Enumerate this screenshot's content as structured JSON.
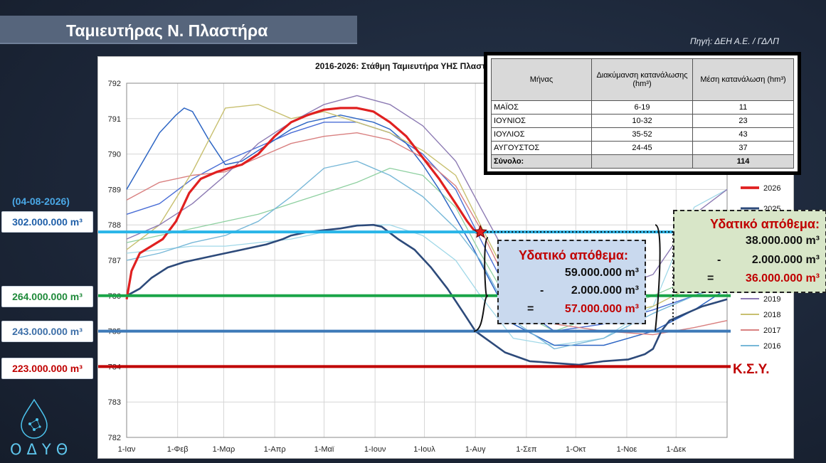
{
  "header": {
    "title": "Ταμιευτήρας Ν. Πλαστήρα",
    "source": "Πηγή: ΔΕΗ Α.Ε. / ΓΔΛΠ"
  },
  "left_panel": {
    "date": "(04-08-2026)",
    "levels": [
      {
        "label": "302.000.000 m³",
        "color": "#1f5fa8"
      },
      {
        "label": "264.000.000 m³",
        "color": "#1f8a3a"
      },
      {
        "label": "243.000.000 m³",
        "color": "#3d6fa8"
      },
      {
        "label": "223.000.000 m³",
        "color": "#c00000"
      }
    ]
  },
  "logo": {
    "text": "ΟΔΥΘ",
    "icon": "water-drop-icon"
  },
  "consumption_table": {
    "headers": [
      "Μήνας",
      "Διακύμανση κατανάλωσης (hm³)",
      "Μέση κατανάλωση (hm³)"
    ],
    "rows": [
      [
        "ΜΑΪΟΣ",
        "6-19",
        "11"
      ],
      [
        "ΙΟΥΝΙΟΣ",
        "10-32",
        "23"
      ],
      [
        "ΙΟΥΛΙΟΣ",
        "35-52",
        "43"
      ],
      [
        "ΑΥΓΟΥΣΤΟΣ",
        "24-45",
        "37"
      ]
    ],
    "total": [
      "Σύνολο:",
      "",
      "114"
    ]
  },
  "box_2026": {
    "title": "Υδατικό απόθεμα:",
    "line1": "59.000.000 m³",
    "line2_sign": "-",
    "line2": "2.000.000 m³",
    "line3_sign": "=",
    "line3": "57.000.000 m³"
  },
  "box_2025": {
    "title": "Υδατικό απόθεμα:",
    "line1": "38.000.000 m³",
    "line2_sign": "-",
    "line2": "2.000.000 m³",
    "line3_sign": "=",
    "line3": "36.000.000 m³"
  },
  "ksy_label": "Κ.Σ.Υ.",
  "colors": {
    "red": "#e02020",
    "dark_blue": "#2d4a7a",
    "light_blue": "#29b5e8",
    "green": "#1aa548",
    "mid_blue": "#3d79b8",
    "ksy_red": "#c00000"
  },
  "chart_data": {
    "type": "line",
    "title": "2016-2026: Στάθμη Ταμιευτήρα ΥΗΣ Πλαστήρα",
    "ylim": [
      782,
      792
    ],
    "yticks": [
      782,
      783,
      784,
      785,
      786,
      787,
      788,
      789,
      790,
      791,
      792
    ],
    "x_tick_labels": [
      "1-Ιαν",
      "1-Φεβ",
      "1-Μαρ",
      "1-Απρ",
      "1-Μαϊ",
      "1-Ιουν",
      "1-Ιουλ",
      "1-Αυγ",
      "1-Σεπ",
      "1-Οκτ",
      "1-Νοε",
      "1-Δεκ"
    ],
    "x_tick_days": [
      0,
      31,
      59,
      90,
      120,
      151,
      181,
      212,
      243,
      273,
      304,
      334
    ],
    "xlim": [
      0,
      365
    ],
    "reference_lines": [
      {
        "y": 787.8,
        "color": "#29b5e8"
      },
      {
        "y": 786.0,
        "color": "#1aa548"
      },
      {
        "y": 785.0,
        "color": "#3d79b8"
      },
      {
        "y": 784.0,
        "color": "#c00000"
      }
    ],
    "legend": [
      "2026",
      "2025",
      "2019",
      "2018",
      "2017",
      "2016"
    ],
    "series": [
      {
        "name": "2026",
        "color": "#e02020",
        "width": 3.2,
        "x": [
          0,
          3,
          8,
          15,
          22,
          30,
          38,
          45,
          55,
          62,
          70,
          80,
          90,
          95,
          100,
          110,
          120,
          130,
          140,
          150,
          160,
          170,
          180,
          190,
          200,
          207,
          212,
          215
        ],
        "y": [
          785.9,
          786.7,
          787.2,
          787.4,
          787.6,
          788.1,
          788.9,
          789.3,
          789.5,
          789.6,
          789.7,
          790.0,
          790.5,
          790.7,
          790.9,
          791.1,
          791.25,
          791.3,
          791.3,
          791.2,
          790.9,
          790.5,
          789.9,
          789.3,
          788.6,
          788.1,
          787.8,
          787.7
        ]
      },
      {
        "name": "2025",
        "color": "#2d4a7a",
        "width": 2.6,
        "x": [
          0,
          8,
          15,
          25,
          35,
          45,
          55,
          70,
          85,
          95,
          100,
          110,
          120,
          130,
          140,
          150,
          155,
          165,
          175,
          185,
          195,
          205,
          212,
          218,
          230,
          245,
          260,
          275,
          290,
          305,
          315,
          320,
          325,
          330,
          340,
          350,
          365
        ],
        "y": [
          786.0,
          786.2,
          786.5,
          786.8,
          786.95,
          787.05,
          787.15,
          787.3,
          787.45,
          787.6,
          787.7,
          787.8,
          787.85,
          787.9,
          787.98,
          788.0,
          787.95,
          787.6,
          787.3,
          786.8,
          786.2,
          785.5,
          785.0,
          784.8,
          784.4,
          784.15,
          784.1,
          784.05,
          784.15,
          784.2,
          784.35,
          784.5,
          785.0,
          785.3,
          785.5,
          785.7,
          785.9
        ]
      },
      {
        "name": "2019",
        "color": "#8c7ab3",
        "width": 1.4,
        "x": [
          0,
          20,
          40,
          60,
          80,
          100,
          120,
          140,
          160,
          180,
          200,
          215,
          235,
          260,
          290,
          320,
          345,
          365
        ],
        "y": [
          787.6,
          788.0,
          788.6,
          789.4,
          790.3,
          790.9,
          791.4,
          791.65,
          791.4,
          790.8,
          789.8,
          788.5,
          786.8,
          786.0,
          786.1,
          786.6,
          788.3,
          789.0
        ]
      },
      {
        "name": "2018",
        "color": "#c8c070",
        "width": 1.4,
        "x": [
          0,
          20,
          40,
          60,
          80,
          100,
          120,
          140,
          160,
          180,
          200,
          215,
          235,
          260,
          290,
          320,
          345,
          365
        ],
        "y": [
          787.3,
          788.0,
          789.5,
          791.3,
          791.4,
          791.0,
          791.2,
          790.9,
          790.6,
          790.1,
          789.4,
          788.0,
          786.2,
          785.6,
          785.4,
          785.7,
          786.3,
          786.8
        ]
      },
      {
        "name": "2017",
        "color": "#d98080",
        "width": 1.4,
        "x": [
          0,
          20,
          40,
          60,
          80,
          100,
          120,
          140,
          160,
          180,
          200,
          215,
          235,
          260,
          290,
          320,
          345,
          365
        ],
        "y": [
          788.7,
          789.2,
          789.4,
          789.5,
          789.9,
          790.3,
          790.5,
          790.6,
          790.4,
          789.9,
          789.1,
          787.9,
          786.0,
          785.2,
          785.0,
          784.9,
          785.1,
          785.3
        ]
      },
      {
        "name": "2016",
        "color": "#78b8d8",
        "width": 1.4,
        "x": [
          0,
          20,
          40,
          60,
          80,
          100,
          120,
          140,
          160,
          180,
          200,
          215,
          235,
          260,
          290,
          320,
          345,
          365
        ],
        "y": [
          787.0,
          787.2,
          787.5,
          787.7,
          788.1,
          788.8,
          789.6,
          789.8,
          789.4,
          788.8,
          787.9,
          787.0,
          785.3,
          784.5,
          784.8,
          785.5,
          786.0,
          786.3
        ]
      },
      {
        "name": "",
        "color": "#2e66c4",
        "width": 1.5,
        "x": [
          0,
          10,
          20,
          30,
          35,
          40,
          50,
          60,
          70,
          80,
          90,
          100,
          110,
          120,
          130,
          140,
          150,
          160,
          170,
          180,
          190,
          200,
          210,
          220,
          235,
          260,
          290,
          320,
          345,
          365
        ],
        "y": [
          789.0,
          789.8,
          790.6,
          791.1,
          791.3,
          791.2,
          790.4,
          789.7,
          789.8,
          790.1,
          790.4,
          790.7,
          790.9,
          791.0,
          791.1,
          791.0,
          790.9,
          790.7,
          790.3,
          789.7,
          789.0,
          788.2,
          787.4,
          786.5,
          785.2,
          784.6,
          784.6,
          785.0,
          785.6,
          786.2
        ]
      },
      {
        "name": "",
        "color": "#4a6ed6",
        "width": 1.4,
        "x": [
          0,
          20,
          40,
          60,
          80,
          100,
          120,
          140,
          160,
          180,
          200,
          215,
          235,
          260,
          290,
          320,
          345,
          365
        ],
        "y": [
          788.3,
          788.6,
          789.3,
          789.8,
          790.2,
          790.6,
          790.9,
          790.9,
          790.6,
          790.0,
          789.0,
          787.6,
          785.8,
          785.0,
          785.2,
          785.6,
          786.0,
          786.4
        ]
      },
      {
        "name": "",
        "color": "#8ed0a0",
        "width": 1.3,
        "x": [
          0,
          20,
          40,
          60,
          80,
          100,
          120,
          140,
          160,
          180,
          200,
          215,
          235,
          260,
          290,
          320,
          345,
          365
        ],
        "y": [
          787.5,
          787.7,
          787.9,
          788.1,
          788.3,
          788.6,
          788.9,
          789.2,
          789.6,
          789.4,
          788.5,
          787.2,
          785.6,
          785.0,
          785.5,
          786.0,
          786.5,
          787.0
        ]
      },
      {
        "name": "",
        "color": "#a0d8e8",
        "width": 1.3,
        "x": [
          0,
          20,
          40,
          60,
          80,
          100,
          120,
          140,
          160,
          180,
          200,
          215,
          235,
          260,
          290,
          320,
          345,
          365
        ],
        "y": [
          787.2,
          787.3,
          787.4,
          787.4,
          787.5,
          787.6,
          787.8,
          788.0,
          788.0,
          787.7,
          787.0,
          786.0,
          784.8,
          784.6,
          784.8,
          785.7,
          788.5,
          789.0
        ]
      }
    ]
  }
}
